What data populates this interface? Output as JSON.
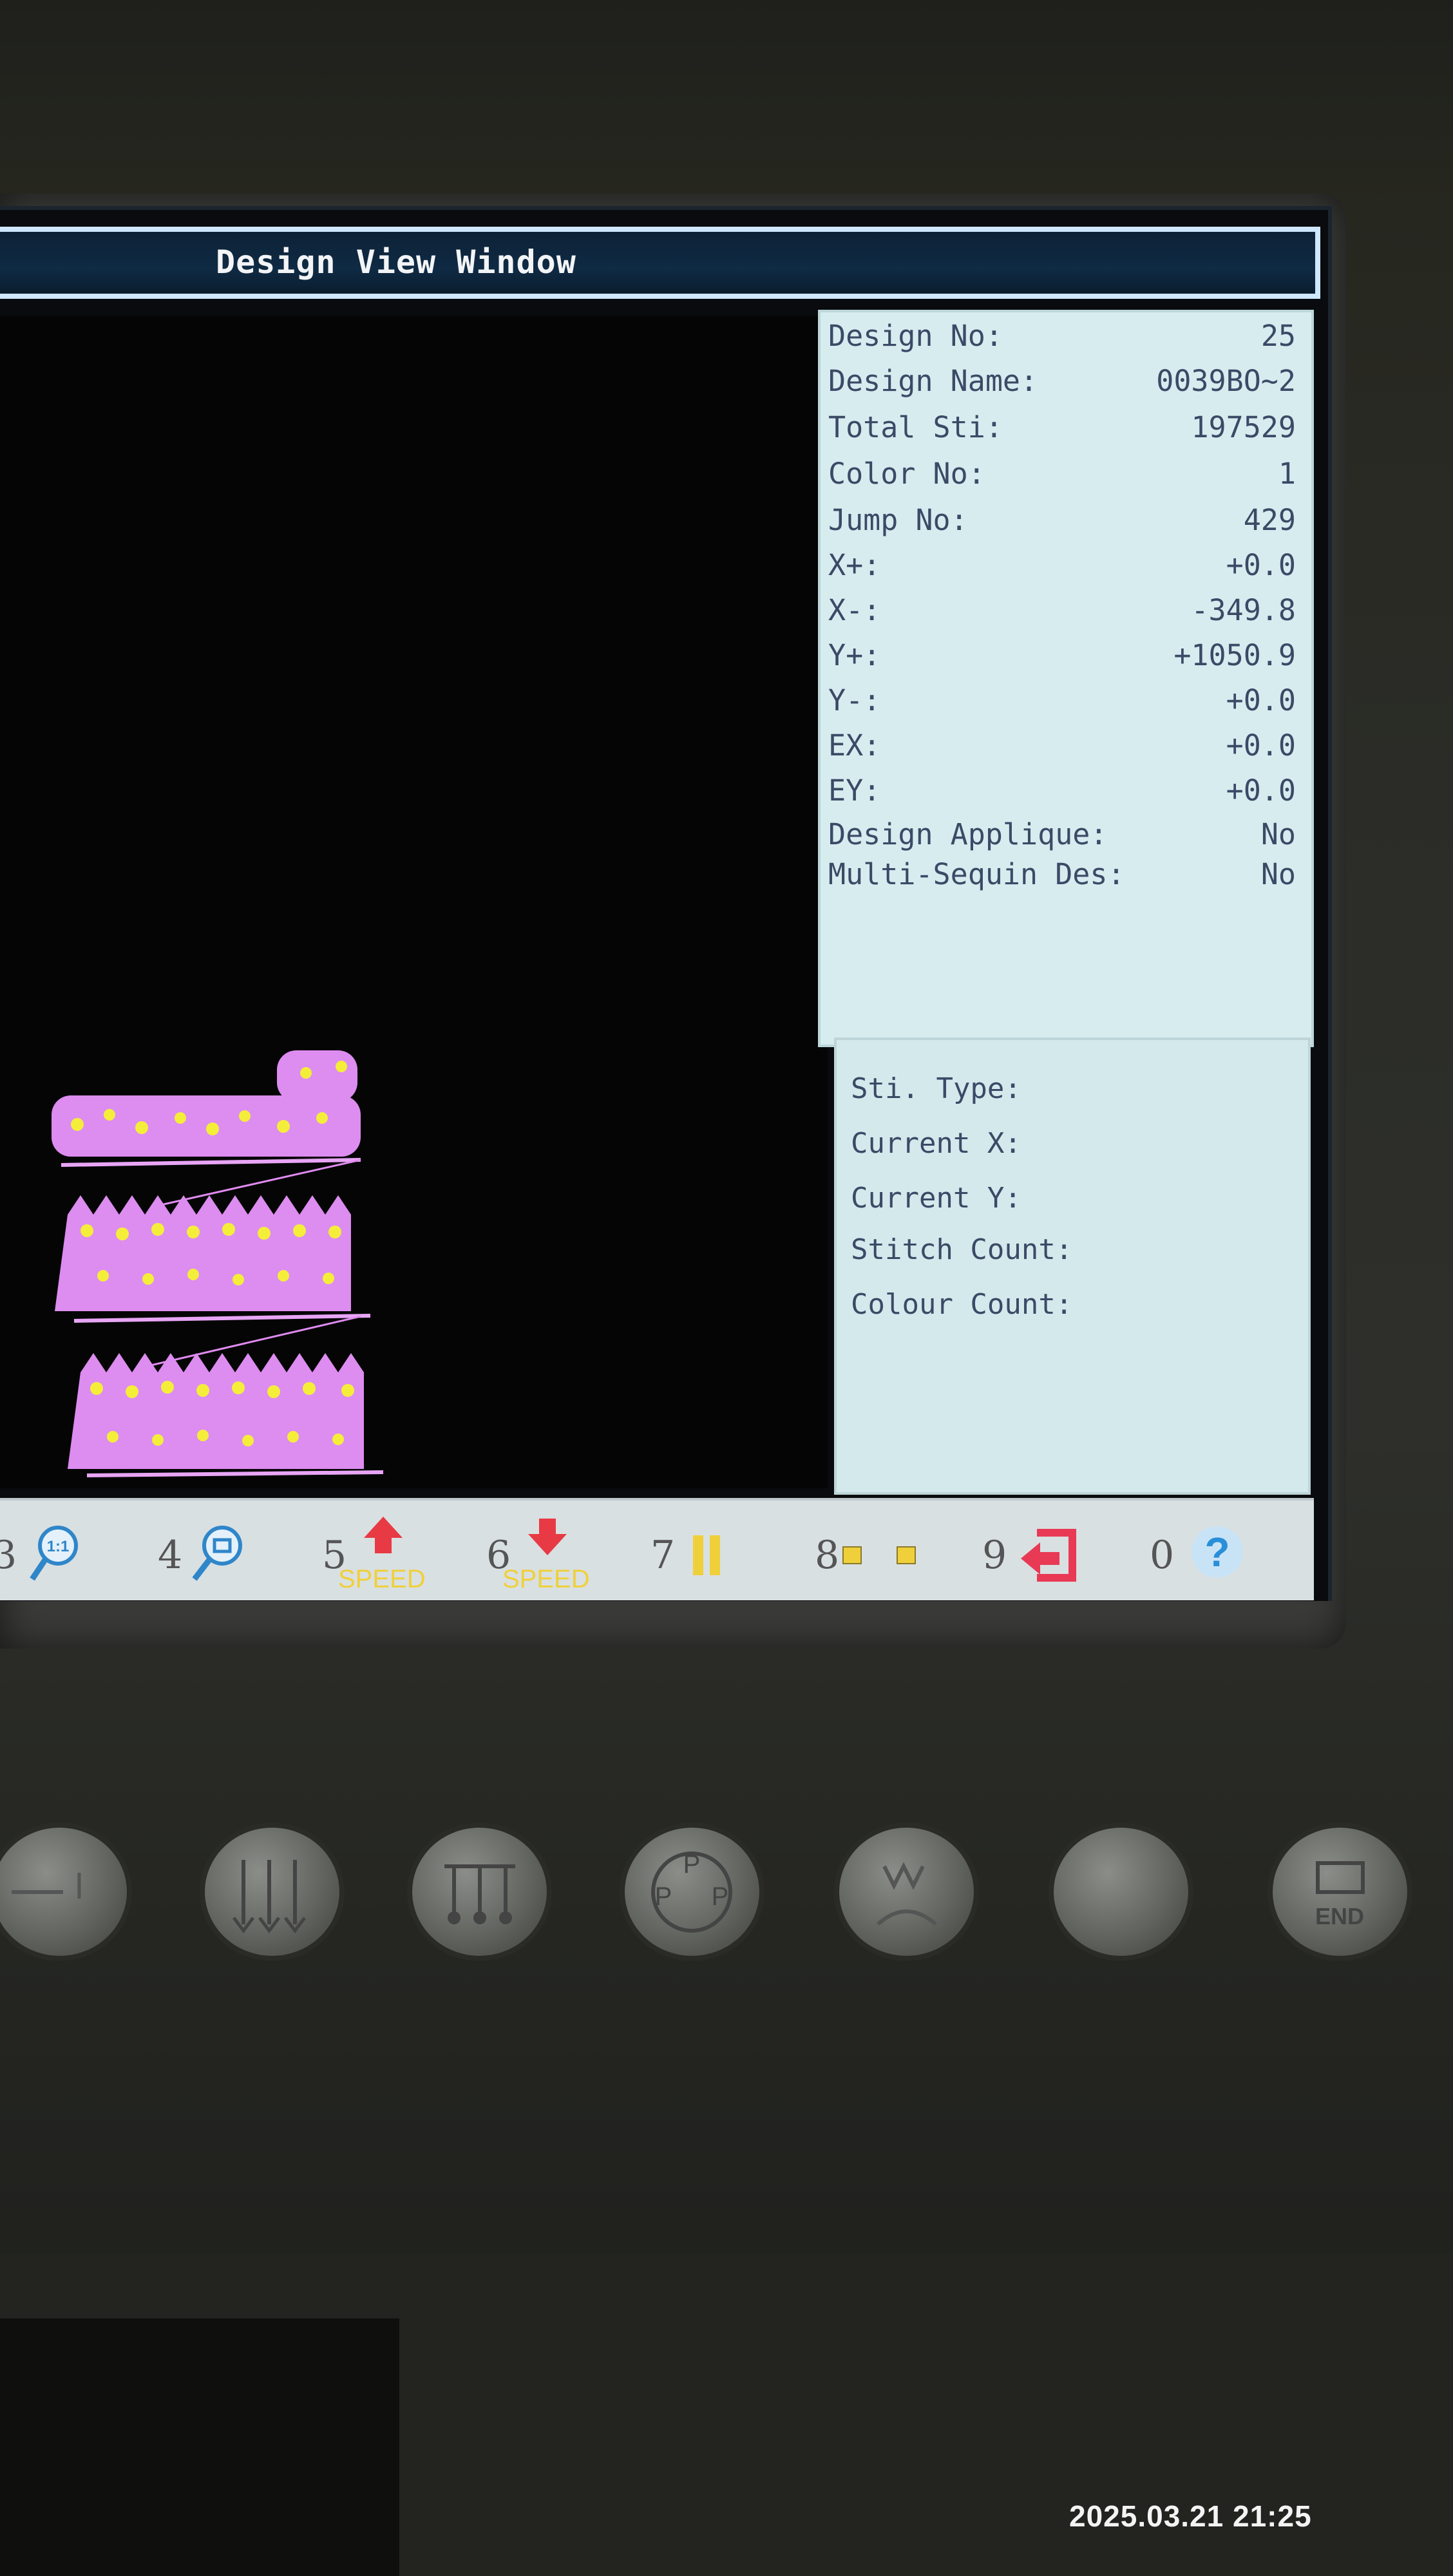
{
  "window": {
    "title": "Design View Window"
  },
  "info": [
    {
      "label": "Design No:",
      "value": "25"
    },
    {
      "label": "Design Name:",
      "value": "0039BO~2"
    },
    {
      "label": "Total Sti:",
      "value": "197529"
    },
    {
      "label": "Color No:",
      "value": "1"
    },
    {
      "label": "Jump No:",
      "value": "429"
    },
    {
      "label": "X+:",
      "value": "+0.0"
    },
    {
      "label": "X-:",
      "value": "-349.8"
    },
    {
      "label": "Y+:",
      "value": "+1050.9"
    },
    {
      "label": "Y-:",
      "value": "+0.0"
    },
    {
      "label": "EX:",
      "value": "+0.0"
    },
    {
      "label": "EY:",
      "value": "+0.0"
    },
    {
      "label": "Design Applique:",
      "value": "No"
    },
    {
      "label": "Multi-Sequin Des:",
      "value": "No"
    }
  ],
  "status": [
    {
      "label": "Sti. Type:"
    },
    {
      "label": "Current X:"
    },
    {
      "label": "Current Y:"
    },
    {
      "label": "Stitch Count:"
    },
    {
      "label": "Colour Count:"
    }
  ],
  "toolbar": [
    {
      "num": "3",
      "icon": "zoom-1to1-icon"
    },
    {
      "num": "4",
      "icon": "zoom-window-icon"
    },
    {
      "num": "5",
      "icon": "speed-up-icon",
      "sub": "SPEED"
    },
    {
      "num": "6",
      "icon": "speed-down-icon",
      "sub": "SPEED"
    },
    {
      "num": "7",
      "icon": "pause-icon"
    },
    {
      "num": "8",
      "icon": "trace-icon"
    },
    {
      "num": "9",
      "icon": "exit-icon"
    },
    {
      "num": "0",
      "icon": "help-icon"
    }
  ],
  "hardware_buttons": [
    {
      "icon": "hw-button-1-icon"
    },
    {
      "icon": "needle-1-icon"
    },
    {
      "icon": "needle-multi-icon"
    },
    {
      "icon": "parameter-cycle-icon"
    },
    {
      "icon": "presser-foot-icon"
    },
    {
      "icon": "blank-button-icon"
    },
    {
      "icon": "end-icon",
      "label": "END"
    }
  ],
  "timestamp": "2025.03.21 21:25",
  "colors": {
    "title_bar": "#0f2a44",
    "info_bg": "#d6ecef",
    "design_pink": "#e08bf0",
    "design_yellow": "#f4ee3a",
    "speed_up": "#e83a44",
    "help": "#2a8fd9"
  }
}
